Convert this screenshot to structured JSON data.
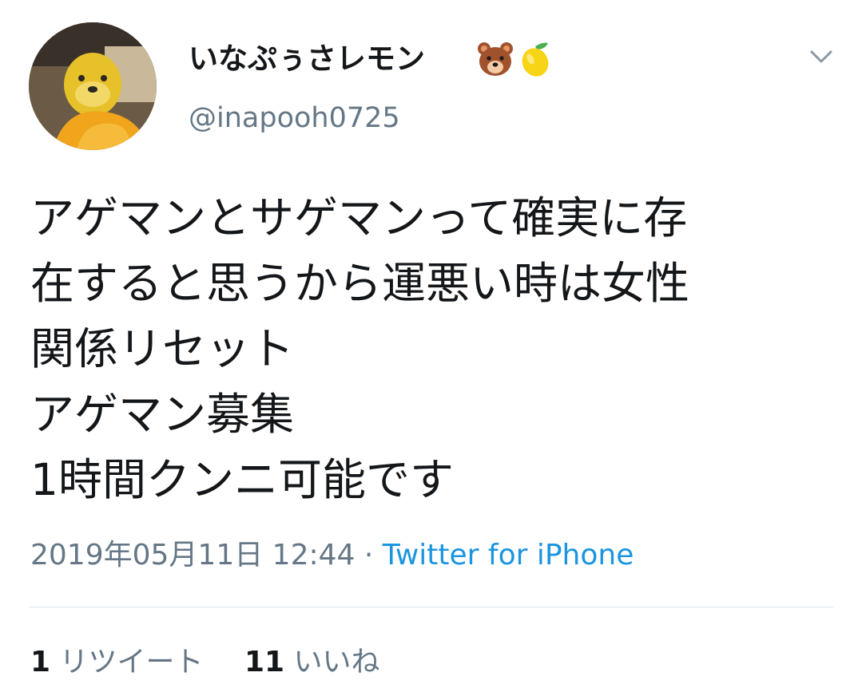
{
  "user": {
    "display_name": "いなぷぅさレモン",
    "handle": "@inapooh0725",
    "name_emojis": [
      "bear-face-icon",
      "lemon-icon"
    ]
  },
  "tweet": {
    "text": "アゲマンとサゲマンって確実に存\n在すると思うから運悪い時は女性\n関係リセット\nアゲマン募集\n1時間クンニ可能です",
    "timestamp": "2019年05月11日 12:44",
    "separator": "·",
    "source": "Twitter for iPhone"
  },
  "stats": {
    "retweets_count": "1",
    "retweets_label": "リツイート",
    "likes_count": "11",
    "likes_label": "いいね"
  },
  "colors": {
    "text": "#14171a",
    "secondary": "#657786",
    "link": "#1b95e0",
    "divider": "#e1e8ed"
  }
}
